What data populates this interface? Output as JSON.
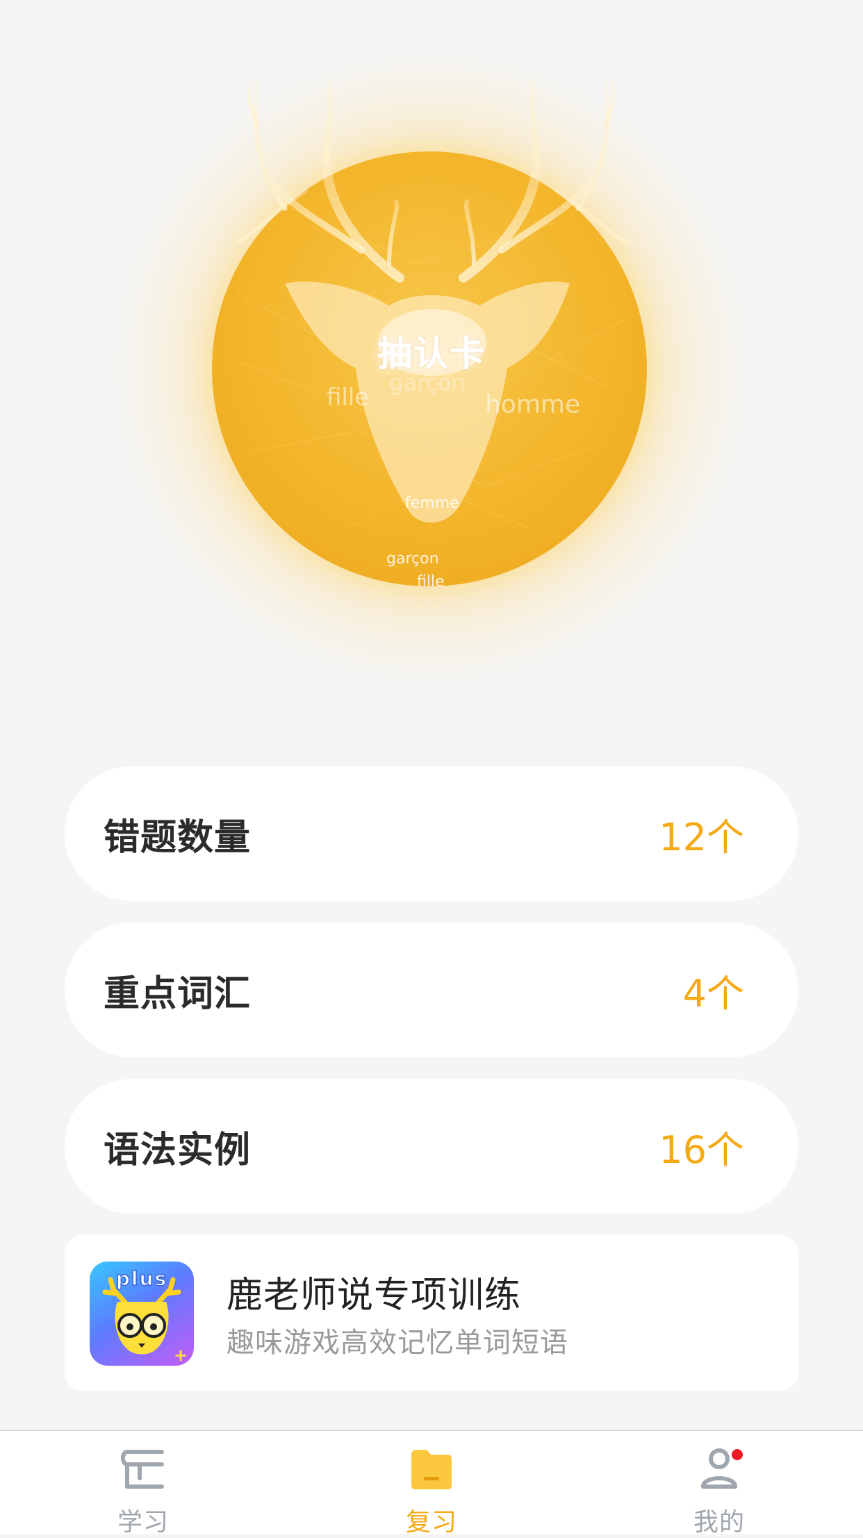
{
  "hero": {
    "draw_card_label": "抽认卡",
    "floating_words": [
      "fille",
      "garçon",
      "homme",
      "femme",
      "garçon",
      "fille"
    ]
  },
  "stats": [
    {
      "label": "错题数量",
      "count": "12",
      "unit": "个"
    },
    {
      "label": "重点词汇",
      "count": "4",
      "unit": "个"
    },
    {
      "label": "语法实例",
      "count": "16",
      "unit": "个"
    }
  ],
  "promo": {
    "title": "鹿老师说专项训练",
    "subtitle": "趣味游戏高效记忆单词短语",
    "icon_text": "plus"
  },
  "tabbar": {
    "tabs": [
      {
        "label": "学习",
        "icon": "book-icon",
        "active": false
      },
      {
        "label": "复习",
        "icon": "folder-icon",
        "active": true
      },
      {
        "label": "我的",
        "icon": "profile-icon",
        "active": false,
        "badge": true
      }
    ]
  },
  "colors": {
    "accent": "#f5a915",
    "background": "#f5f5f5",
    "disc": "#f3b52a",
    "badge": "#ee1b24",
    "inactive": "#a0a6ad"
  }
}
